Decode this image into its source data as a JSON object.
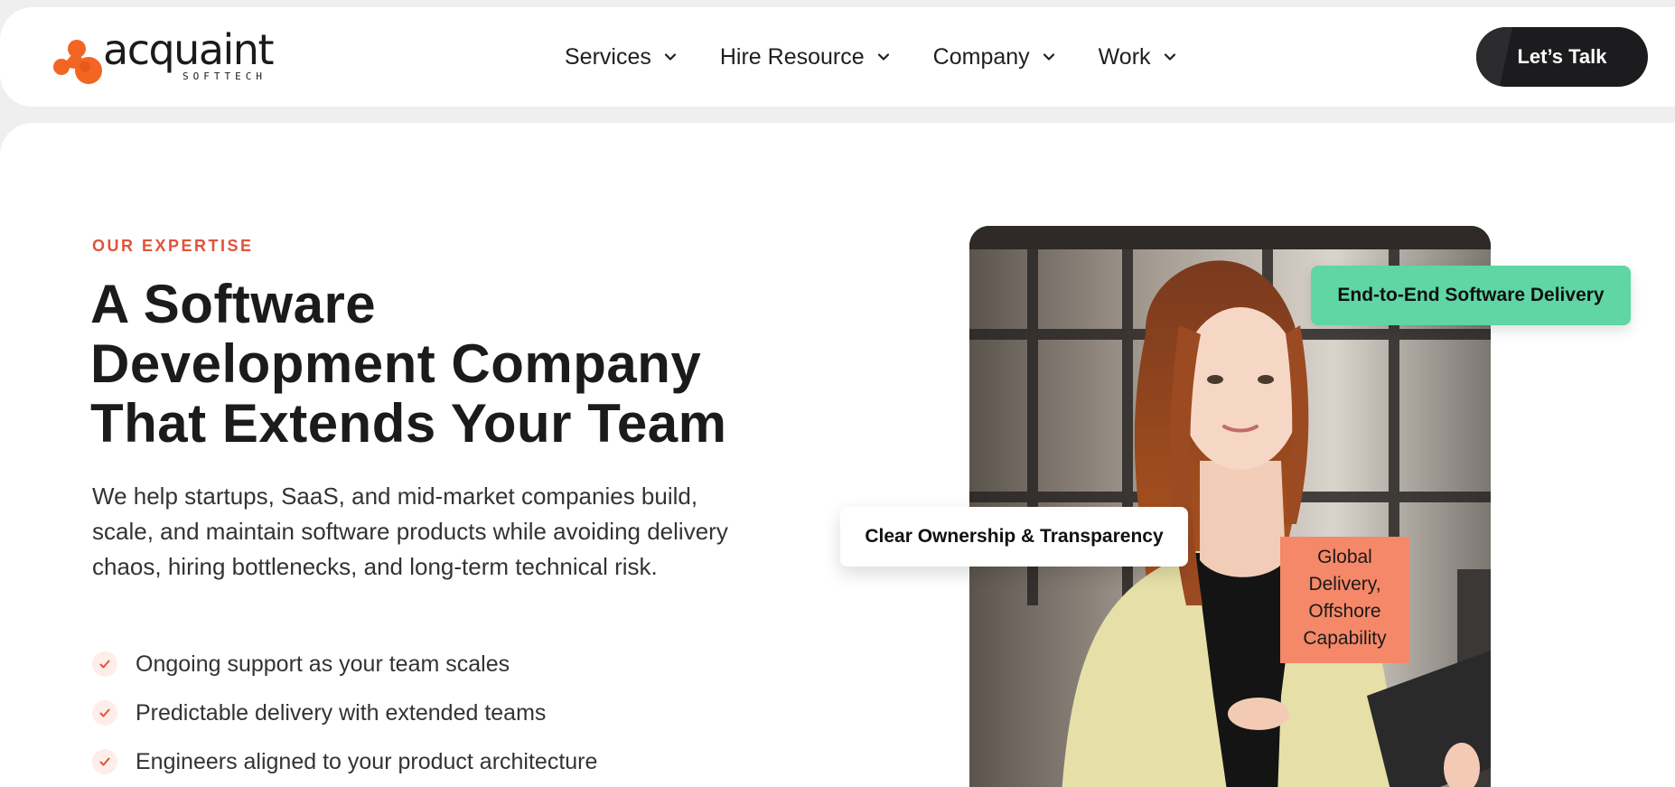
{
  "header": {
    "logo": {
      "name": "acquaint",
      "sub": "SOFTTECH",
      "icon": "acquaint-logo-icon"
    },
    "nav": [
      {
        "label": "Services",
        "icon": "chevron-down-icon"
      },
      {
        "label": "Hire Resource",
        "icon": "chevron-down-icon"
      },
      {
        "label": "Company",
        "icon": "chevron-down-icon"
      },
      {
        "label": "Work",
        "icon": "chevron-down-icon"
      }
    ],
    "cta_label": "Let’s Talk"
  },
  "hero": {
    "eyebrow": "OUR EXPERTISE",
    "headline": [
      "A Software",
      "Development Company",
      "That Extends Your Team"
    ],
    "lead": "We help startups, SaaS, and mid-market companies build, scale, and maintain software products while avoiding delivery chaos, hiring bottlenecks, and long-term technical risk.",
    "bullets": [
      "Ongoing support as your team scales",
      "Predictable delivery with extended teams",
      "Engineers aligned to your product architecture"
    ]
  },
  "visual": {
    "badges": {
      "green": "End-to-End Software Delivery",
      "white": "Clear Ownership & Transparency",
      "orange": [
        "Global",
        "Delivery,",
        "Offshore",
        "Capability"
      ]
    }
  },
  "colors": {
    "accent": "#e0533a",
    "cta_bg": "#1c1c1e",
    "badge_green": "#5fd6a3",
    "badge_orange": "#f58868",
    "page_bg": "#efefef"
  }
}
